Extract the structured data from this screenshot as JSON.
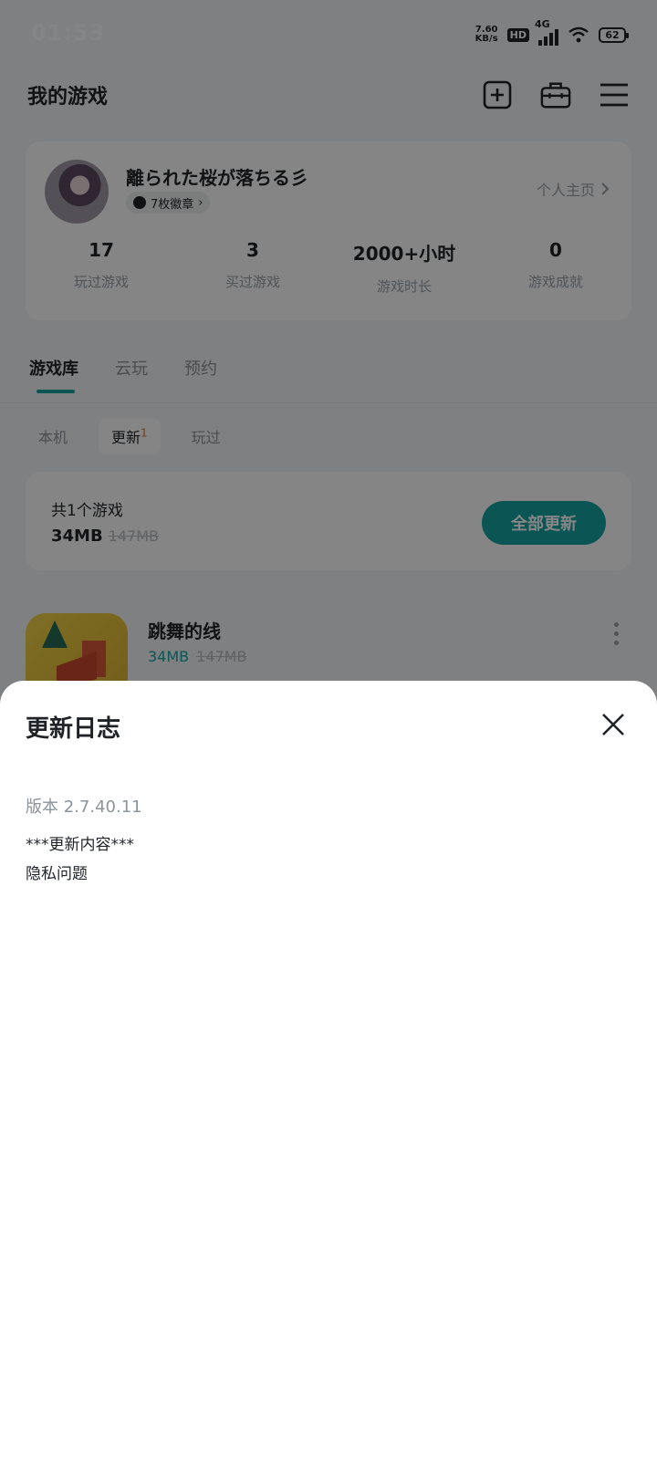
{
  "status_bar": {
    "time": "01:53",
    "net_speed_value": "7.60",
    "net_speed_unit": "KB/s",
    "hd_label": "HD",
    "network_label": "4G",
    "battery": "62"
  },
  "header": {
    "title": "我的游戏",
    "icons": [
      "add-square-icon",
      "toolbox-icon",
      "menu-icon"
    ]
  },
  "profile": {
    "username": "離られた桜が落ちる彡",
    "badge_text": "7枚徽章",
    "homepage_label": "个人主页",
    "stats": [
      {
        "value": "17",
        "label": "玩过游戏"
      },
      {
        "value": "3",
        "label": "买过游戏"
      },
      {
        "value": "2000+小时",
        "label": "游戏时长"
      },
      {
        "value": "0",
        "label": "游戏成就"
      }
    ]
  },
  "tabs": {
    "items": [
      "游戏库",
      "云玩",
      "预约"
    ],
    "active": "游戏库"
  },
  "subtabs": {
    "local": "本机",
    "updates": "更新",
    "updates_count": "1",
    "played": "玩过"
  },
  "update_card": {
    "count_text": "共1个游戏",
    "size_new": "34MB",
    "size_old": "147MB",
    "update_all_button": "全部更新"
  },
  "game": {
    "name": "跳舞的线",
    "size_new": "34MB",
    "size_old": "147MB"
  },
  "sheet": {
    "title": "更新日志",
    "version": "版本 2.7.40.11",
    "changelog_heading": "***更新内容***",
    "changelog_items": [
      "隐私问题"
    ]
  },
  "colors": {
    "accent": "#17a3a3",
    "overlay": "rgba(0,0,0,0.48)",
    "badge_count": "#e07a2b"
  }
}
